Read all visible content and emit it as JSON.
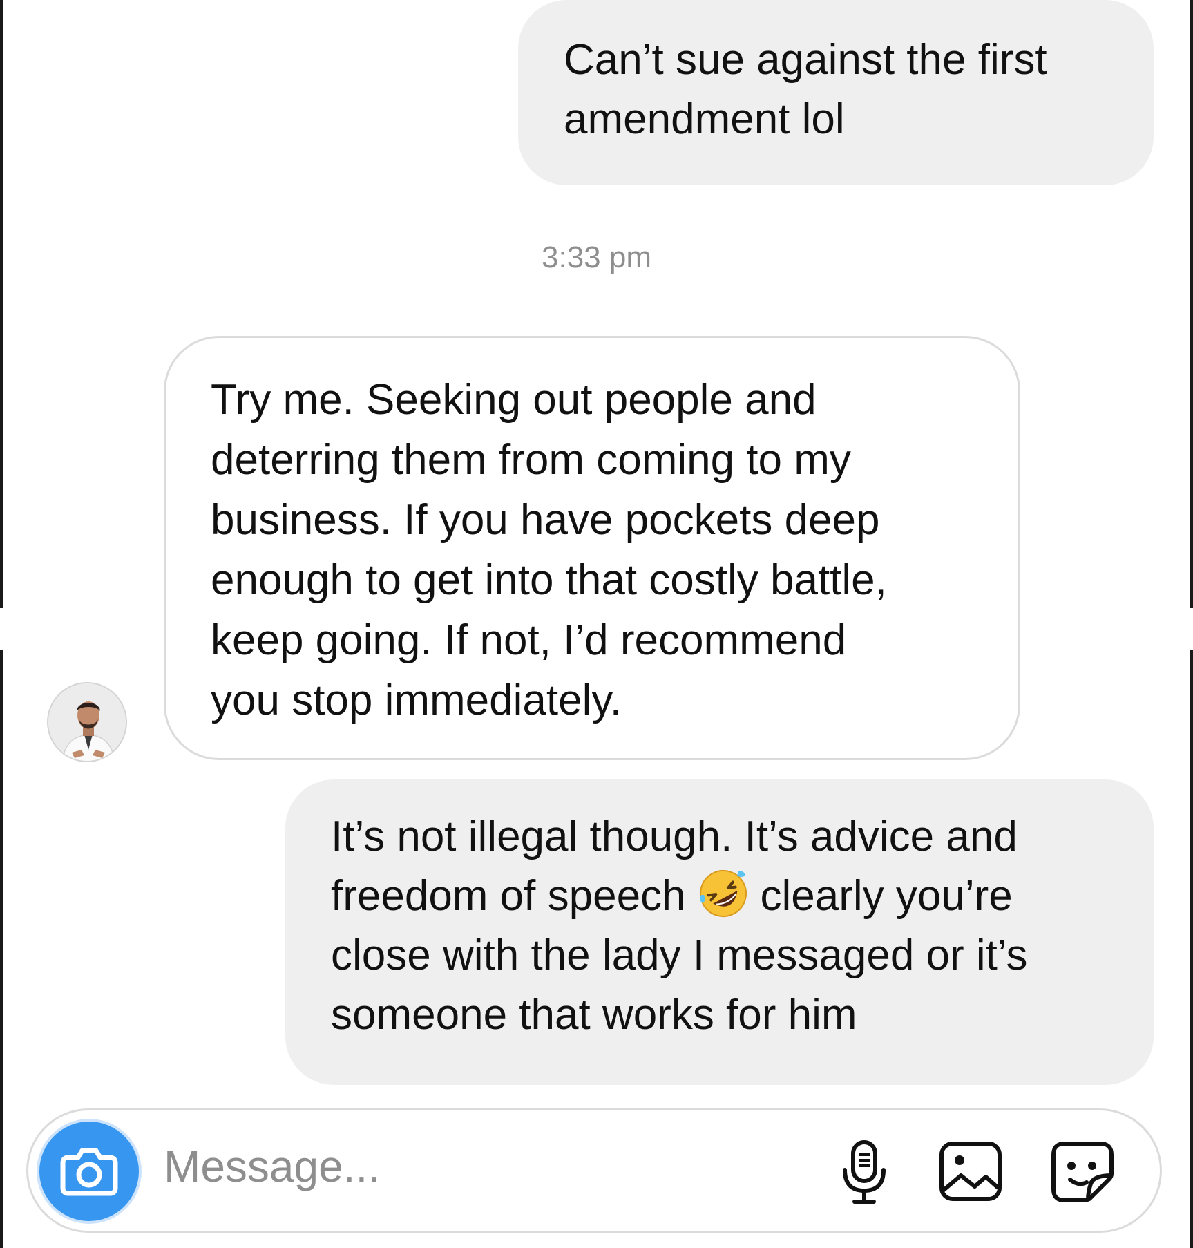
{
  "conversation": {
    "messages": [
      {
        "sender": "me",
        "lines": [
          "Can’t sue against the first",
          "amendment lol"
        ]
      },
      {
        "type": "timestamp",
        "text": "3:33 pm"
      },
      {
        "sender": "other",
        "lines": [
          "Try me. Seeking out people and",
          "deterring them from coming to my",
          "business. If you have pockets deep",
          "enough to get into that costly battle,",
          "keep going. If not, I’d recommend",
          "you stop immediately."
        ]
      },
      {
        "sender": "me",
        "lines": [
          "It’s not illegal though. It’s advice and",
          "freedom of speech",
          "clearly you’re",
          "close with the lady I messaged or it’s",
          "someone that works for him"
        ],
        "emoji": "rolling-on-the-floor-laughing"
      }
    ]
  },
  "composer": {
    "placeholder": "Message...",
    "icons": [
      "camera-icon",
      "microphone-icon",
      "gallery-icon",
      "sticker-icon"
    ],
    "accent_color": "#3797f0"
  }
}
